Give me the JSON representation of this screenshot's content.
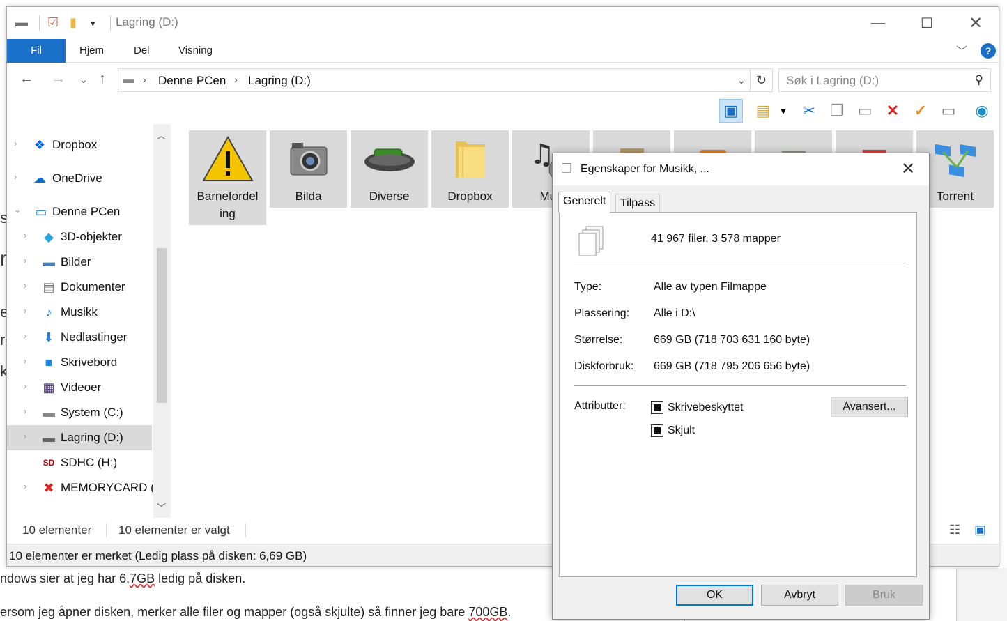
{
  "background": {
    "line1_prefix": "ndows sier at jeg har 6,",
    "line1_underlined": "7GB",
    "line1_suffix": " ledig på disken.",
    "line2_prefix": "ersom jeg åpner disken, merker alle filer og mapper (også skjulte) så finner jeg bare ",
    "line2_underlined": "700GB",
    "line2_suffix": "."
  },
  "explorer": {
    "title": "Lagring (D:)",
    "ribbon_tabs": [
      "Fil",
      "Hjem",
      "Del",
      "Visning"
    ],
    "breadcrumb": [
      "Denne PCen",
      "Lagring (D:)"
    ],
    "search_placeholder": "Søk i Lagring (D:)",
    "nav_items": [
      {
        "label": "Dropbox",
        "icon": "dropbox-icon",
        "level": 0
      },
      {
        "label": "OneDrive",
        "icon": "onedrive-icon",
        "level": 0
      },
      {
        "label": "Denne PCen",
        "icon": "computer-icon",
        "level": 0,
        "expanded": true
      },
      {
        "label": "3D-objekter",
        "icon": "cube-icon",
        "level": 1
      },
      {
        "label": "Bilder",
        "icon": "pictures-icon",
        "level": 1
      },
      {
        "label": "Dokumenter",
        "icon": "documents-icon",
        "level": 1
      },
      {
        "label": "Musikk",
        "icon": "music-note-icon",
        "level": 1
      },
      {
        "label": "Nedlastinger",
        "icon": "download-icon",
        "level": 1
      },
      {
        "label": "Skrivebord",
        "icon": "desktop-icon",
        "level": 1
      },
      {
        "label": "Videoer",
        "icon": "film-icon",
        "level": 1
      },
      {
        "label": "System (C:)",
        "icon": "windows-drive-icon",
        "level": 1
      },
      {
        "label": "Lagring (D:)",
        "icon": "drive-icon",
        "level": 1,
        "selected": true
      },
      {
        "label": "SDHC (H:)",
        "icon": "sd-card-icon",
        "level": 1
      },
      {
        "label": "MEMORYCARD (",
        "icon": "memorycard-error-icon",
        "level": 1
      }
    ],
    "folders": [
      {
        "label": "Barnefordel ing",
        "icon": "warning-icon"
      },
      {
        "label": "Bilda",
        "icon": "camera-icon"
      },
      {
        "label": "Diverse",
        "icon": "green-drive-icon"
      },
      {
        "label": "Dropbox",
        "icon": "folder-icon"
      },
      {
        "label": "Mus",
        "icon": "music-folder-icon"
      },
      {
        "label": "",
        "icon": "box-folder-icon"
      },
      {
        "label": "",
        "icon": "orange-folder-icon"
      },
      {
        "label": "",
        "icon": "tools-folder-icon"
      },
      {
        "label": "",
        "icon": "pdf-folder-icon"
      },
      {
        "label": "Torrent",
        "icon": "network-icon"
      }
    ],
    "status_count": "10 elementer",
    "status_selected": "10 elementer er valgt",
    "bottom_status": "10 elementer er merket (Ledig plass på disken: 6,69 GB)"
  },
  "dialog": {
    "title": "Egenskaper for Musikk, ...",
    "tabs": [
      "Generelt",
      "Tilpass"
    ],
    "summary": "41 967 filer, 3 578 mapper",
    "rows": [
      {
        "label": "Type:",
        "value": "Alle av typen Filmappe"
      },
      {
        "label": "Plassering:",
        "value": "Alle i D:\\"
      },
      {
        "label": "Størrelse:",
        "value": "669 GB (718 703 631 160 byte)"
      },
      {
        "label": "Diskforbruk:",
        "value": "669 GB (718 795 206 656 byte)"
      }
    ],
    "attributes_label": "Attributter:",
    "attr_readonly": "Skrivebeskyttet",
    "attr_hidden": "Skjult",
    "advanced_button": "Avansert...",
    "ok_button": "OK",
    "cancel_button": "Avbryt",
    "apply_button": "Bruk"
  }
}
